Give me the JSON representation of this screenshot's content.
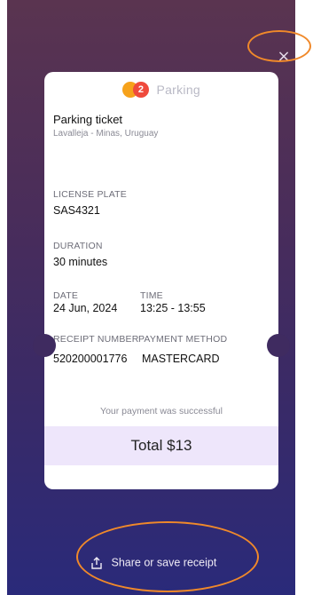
{
  "modal": {
    "close_glyph": "×"
  },
  "ticket": {
    "brand": {
      "logo_text": "2",
      "name": "Parking"
    },
    "title": "Parking ticket",
    "location": "Lavalleja - Minas, Uruguay",
    "license_plate_label": "LICENSE PLATE",
    "license_plate_value": "SAS4321",
    "duration_label": "DURATION",
    "duration_value": "30 minutes",
    "date_label": "DATE",
    "date_value": "24 Jun, 2024",
    "time_label": "TIME",
    "time_value": "13:25 - 13:55",
    "receipt_number_label": "RECEIPT NUMBER",
    "receipt_number_value": "520200001776",
    "payment_method_label": "PAYMENT METHOD",
    "payment_method_value": "MASTERCARD",
    "success_message": "Your payment was successful",
    "total": "Total $13"
  },
  "footer": {
    "share_label": "Share or save receipt"
  },
  "colors": {
    "annotation": "#f0892a",
    "total_bg": "#eee6fb",
    "logo_primary": "#ef4a3c",
    "logo_secondary": "#f6a21b"
  }
}
